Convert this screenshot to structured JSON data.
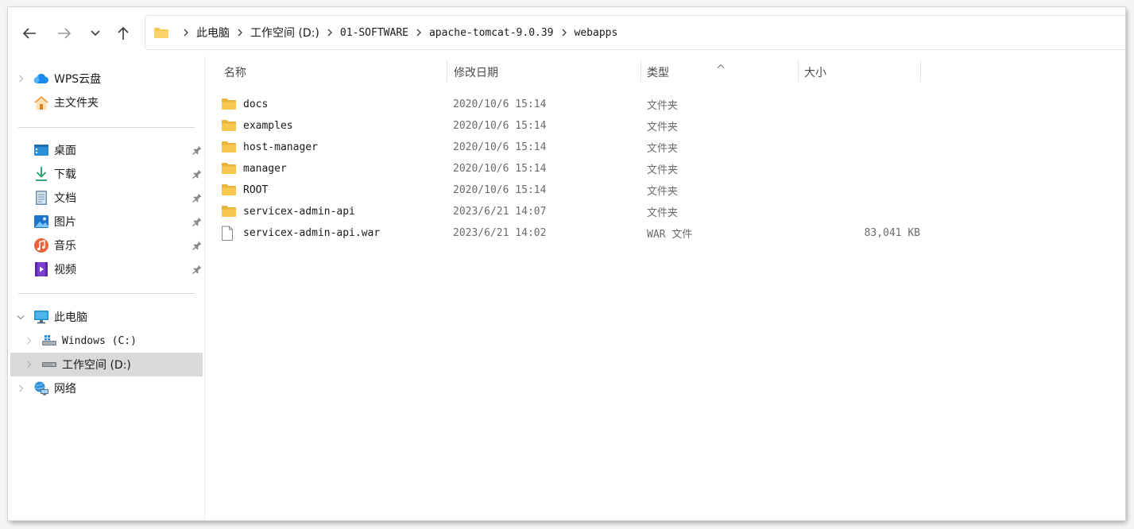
{
  "breadcrumb": [
    "此电脑",
    "工作空间 (D:)",
    "01-SOFTWARE",
    "apache-tomcat-9.0.39",
    "webapps"
  ],
  "sidebar": {
    "top": [
      {
        "label": "WPS云盘",
        "icon": "cloud-icon",
        "has_chevron": true
      },
      {
        "label": "主文件夹",
        "icon": "home-icon",
        "has_chevron": false
      }
    ],
    "quick": [
      {
        "label": "桌面",
        "icon": "desktop-icon"
      },
      {
        "label": "下载",
        "icon": "download-icon"
      },
      {
        "label": "文档",
        "icon": "document-icon"
      },
      {
        "label": "图片",
        "icon": "pictures-icon"
      },
      {
        "label": "音乐",
        "icon": "music-icon"
      },
      {
        "label": "视频",
        "icon": "video-icon"
      }
    ],
    "pc": {
      "label": "此电脑",
      "icon": "computer-icon"
    },
    "drives": [
      {
        "label": "Windows (C:)",
        "icon": "windows-drive-icon"
      },
      {
        "label": "工作空间 (D:)",
        "icon": "drive-icon",
        "selected": true
      }
    ],
    "network": {
      "label": "网络",
      "icon": "network-icon"
    }
  },
  "columns": {
    "name": "名称",
    "date": "修改日期",
    "type": "类型",
    "size": "大小"
  },
  "files": [
    {
      "name": "docs",
      "date": "2020/10/6 15:14",
      "type": "文件夹",
      "size": "",
      "kind": "folder"
    },
    {
      "name": "examples",
      "date": "2020/10/6 15:14",
      "type": "文件夹",
      "size": "",
      "kind": "folder"
    },
    {
      "name": "host-manager",
      "date": "2020/10/6 15:14",
      "type": "文件夹",
      "size": "",
      "kind": "folder"
    },
    {
      "name": "manager",
      "date": "2020/10/6 15:14",
      "type": "文件夹",
      "size": "",
      "kind": "folder"
    },
    {
      "name": "ROOT",
      "date": "2020/10/6 15:14",
      "type": "文件夹",
      "size": "",
      "kind": "folder"
    },
    {
      "name": "servicex-admin-api",
      "date": "2023/6/21 14:07",
      "type": "文件夹",
      "size": "",
      "kind": "folder"
    },
    {
      "name": "servicex-admin-api.war",
      "date": "2023/6/21 14:02",
      "type": "WAR 文件",
      "size": "83,041 KB",
      "kind": "file"
    }
  ],
  "colors": {
    "folder": "#f8c74d",
    "selected": "#d9d9d9",
    "accent": "#0067c0"
  }
}
